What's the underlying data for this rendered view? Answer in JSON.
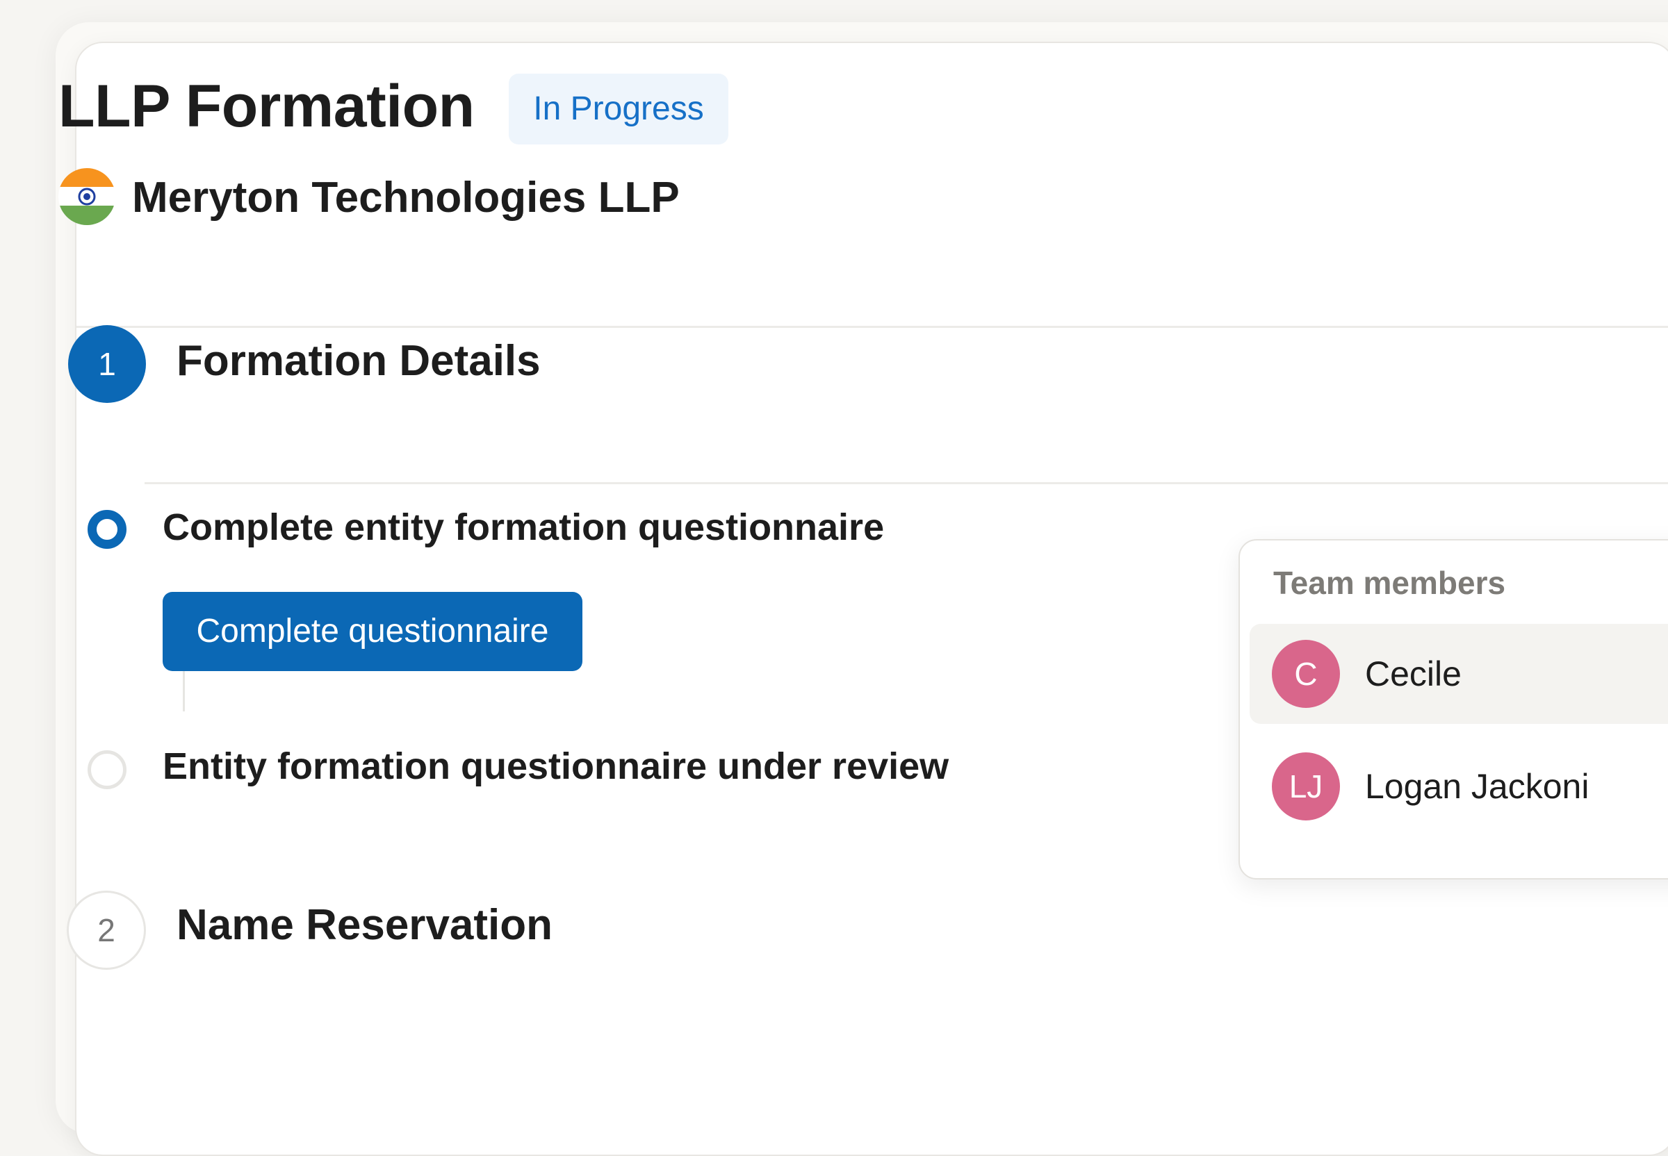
{
  "header": {
    "title": "LLP Formation",
    "status": "In Progress",
    "company": "Meryton Technologies LLP",
    "flag_icon": "india-flag-icon"
  },
  "steps": [
    {
      "number": "1",
      "title": "Formation Details",
      "state": "active",
      "tasks": [
        {
          "label": "Complete entity formation questionnaire",
          "state": "active",
          "action_label": "Complete questionnaire"
        },
        {
          "label": "Entity formation questionnaire under review",
          "state": "pending"
        }
      ]
    },
    {
      "number": "2",
      "title": "Name Reservation",
      "state": "inactive"
    }
  ],
  "team_panel": {
    "title": "Team members",
    "members": [
      {
        "initials": "C",
        "name": "Cecile",
        "highlighted": true
      },
      {
        "initials": "LJ",
        "name": "Logan Jackoni",
        "highlighted": false
      }
    ]
  },
  "colors": {
    "accent": "#0b68b5",
    "badge_bg": "#eef5fc",
    "badge_text": "#1670c7",
    "avatar": "#d9668b",
    "background": "#f6f5f2"
  }
}
